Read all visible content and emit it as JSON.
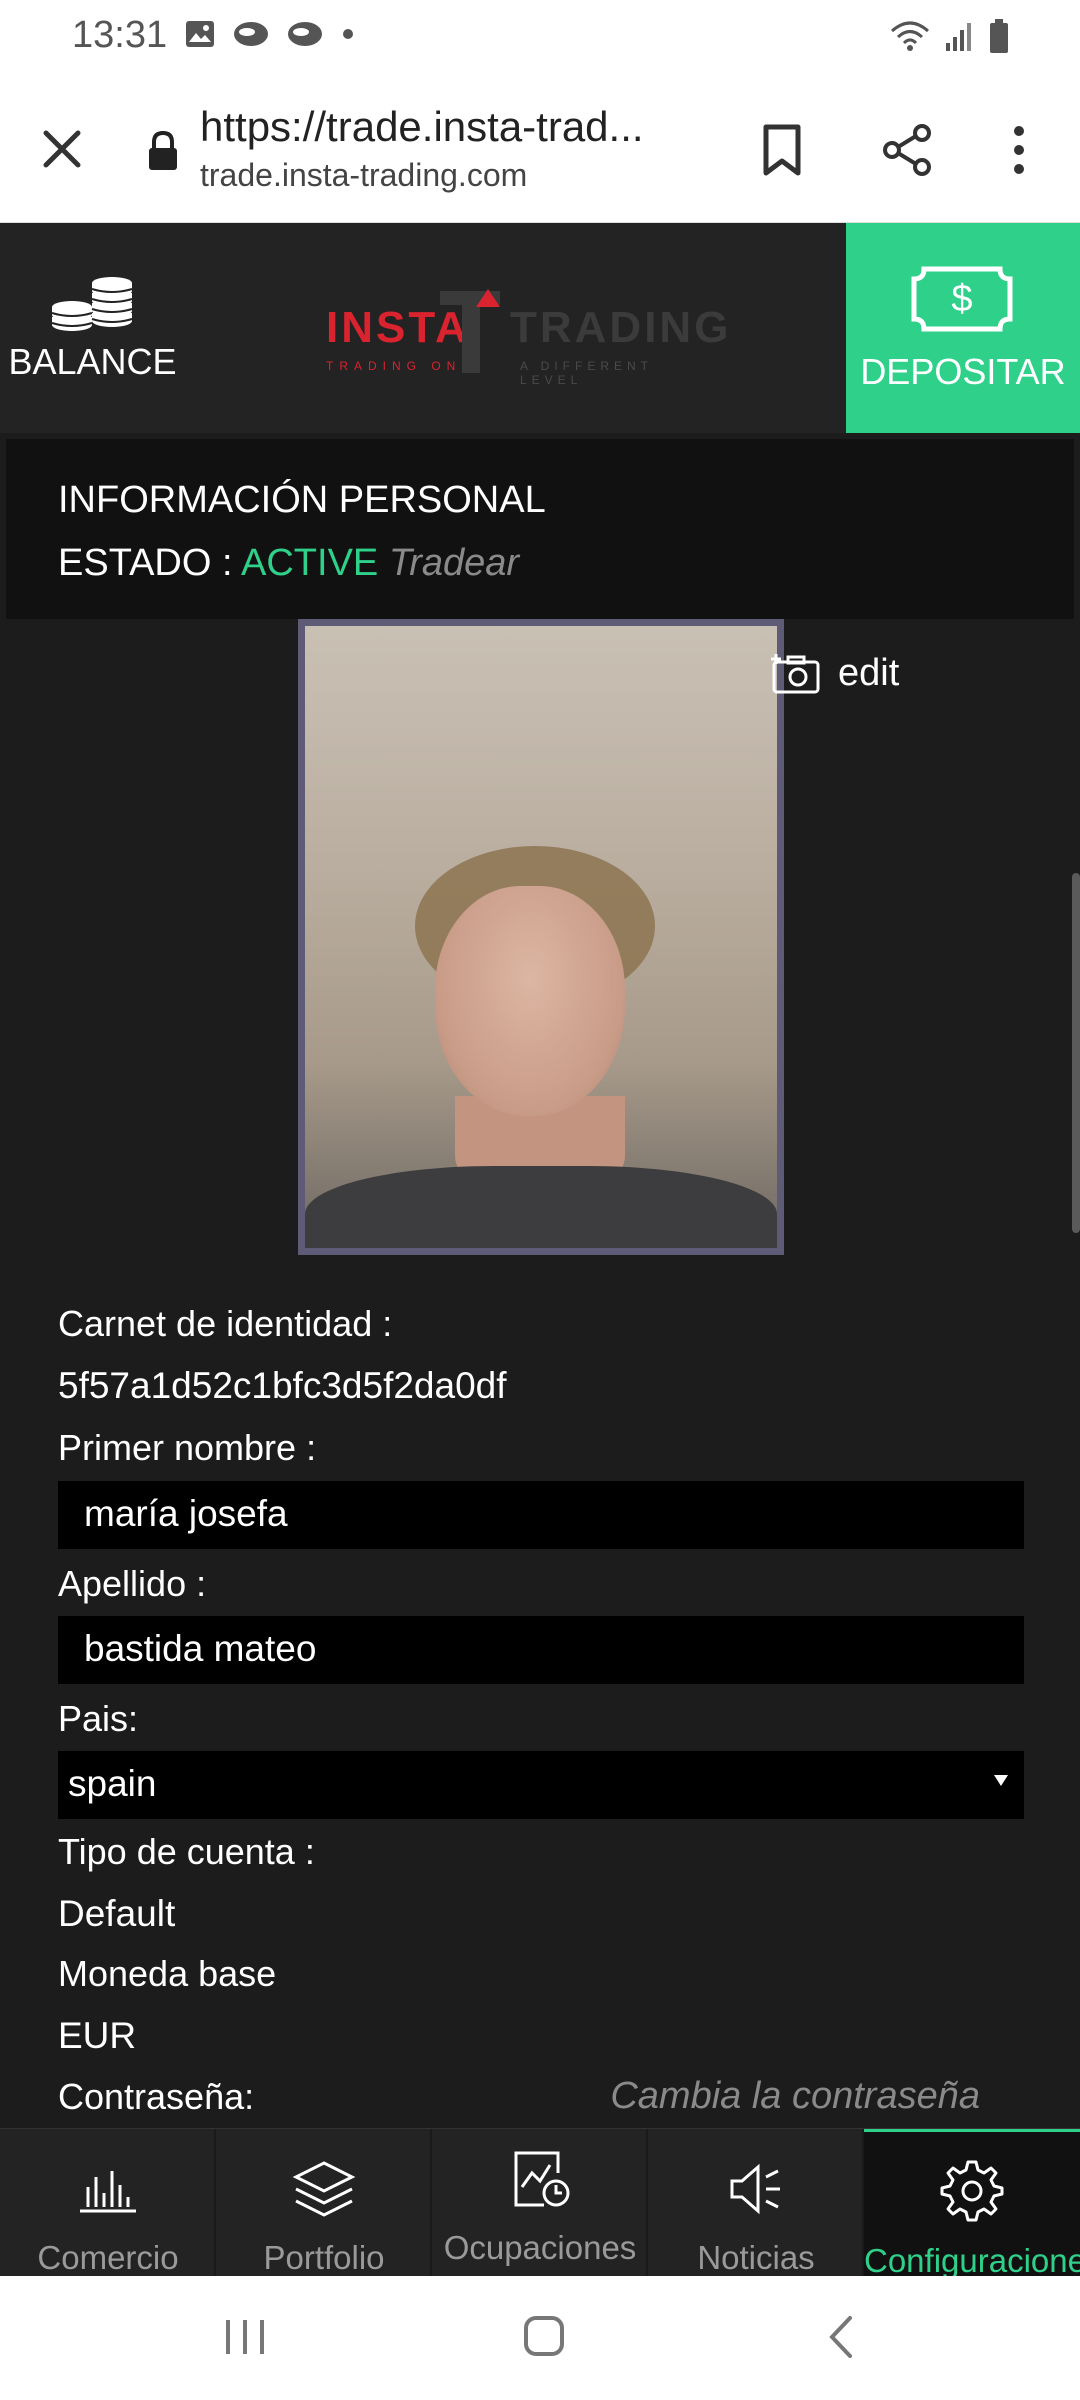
{
  "status_bar": {
    "time": "13:31"
  },
  "browser": {
    "url_main": "https://trade.insta-trad...",
    "url_sub": "trade.insta-trading.com"
  },
  "header": {
    "balance_label": "BALANCE",
    "logo": {
      "insta": "INSTA",
      "trading": "TRADING",
      "tagline_left": "TRADING ON",
      "tagline_right": "A DIFFERENT LEVEL"
    },
    "deposit_label": "DEPOSITAR",
    "deposit_color": "#2fd18a"
  },
  "personal": {
    "title": "INFORMACIÓN PERSONAL",
    "status_label": "ESTADO :",
    "status_value": "ACTIVE",
    "status_action": "Tradear",
    "edit_label": "edit",
    "id_label": "Carnet de identidad :",
    "id_value": "5f57a1d52c1bfc3d5f2da0df",
    "first_name_label": "Primer nombre :",
    "first_name_value": "maría josefa",
    "last_name_label": "Apellido :",
    "last_name_value": "bastida mateo",
    "country_label": "Pais:",
    "country_value": "spain",
    "account_type_label": "Tipo de cuenta :",
    "account_type_value": "Default",
    "currency_label": "Moneda base",
    "currency_value": "EUR",
    "password_label": "Contraseña:",
    "change_password": "Cambia la contraseña"
  },
  "nav": {
    "items": [
      {
        "label": "Comercio",
        "icon": "bar-chart-icon"
      },
      {
        "label": "Portfolio",
        "icon": "layers-icon"
      },
      {
        "label": "Ocupaciones",
        "icon": "clock-chart-icon"
      },
      {
        "label": "Noticias",
        "icon": "megaphone-icon"
      },
      {
        "label": "Configuraciones",
        "icon": "gear-icon"
      }
    ],
    "active_index": 4,
    "active_color": "#2fd18a"
  }
}
